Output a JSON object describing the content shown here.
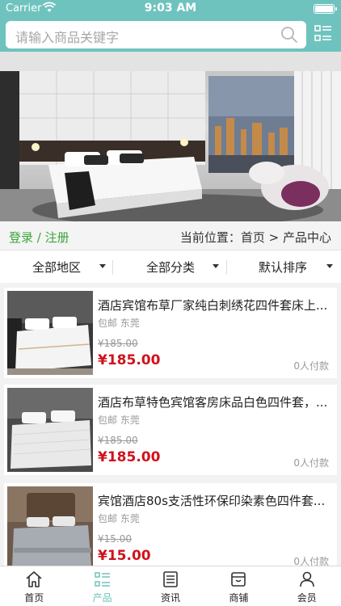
{
  "status_bar": {
    "carrier": "Carrier",
    "time": "9:03 AM"
  },
  "search": {
    "placeholder": "请输入商品关键字"
  },
  "breadcrumb": {
    "login": "登录 / 注册",
    "location": "当前位置：首页 > 产品中心"
  },
  "filters": [
    "全部地区",
    "全部分类",
    "默认排序"
  ],
  "products": [
    {
      "title": "酒店宾馆布草厂家纯白刺绣花四件套床上...",
      "shipping": "包邮",
      "city": "东莞",
      "old_price": "¥185.00",
      "price": "¥185.00",
      "paid": "0人付款"
    },
    {
      "title": "酒店布草特色宾馆客房床品白色四件套，...",
      "shipping": "包邮",
      "city": "东莞",
      "old_price": "¥185.00",
      "price": "¥185.00",
      "paid": "0人付款"
    },
    {
      "title": "宾馆酒店80s支活性环保印染素色四件套...",
      "shipping": "包邮",
      "city": "东莞",
      "old_price": "¥15.00",
      "price": "¥15.00",
      "paid": "0人付款"
    }
  ],
  "tabs": [
    {
      "label": "首页",
      "icon": "home-icon"
    },
    {
      "label": "产品",
      "icon": "list-icon"
    },
    {
      "label": "资讯",
      "icon": "news-icon"
    },
    {
      "label": "商铺",
      "icon": "store-icon"
    },
    {
      "label": "会员",
      "icon": "user-icon"
    }
  ],
  "active_tab": "产品",
  "colors": {
    "accent": "#6fc3be",
    "price": "#d0121b",
    "login": "#3aa53a"
  }
}
